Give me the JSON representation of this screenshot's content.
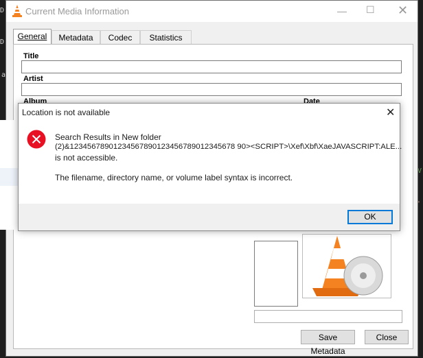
{
  "vlc": {
    "title": "Current Media Information",
    "tabs": [
      {
        "label": "General"
      },
      {
        "label": "Metadata"
      },
      {
        "label": "Codec"
      },
      {
        "label": "Statistics"
      }
    ],
    "labels": {
      "title": "Title",
      "artist": "Artist",
      "album": "Album",
      "date": "Date"
    },
    "buttons": {
      "save": "Save Metadata",
      "close": "Close"
    }
  },
  "dialog": {
    "title": "Location is not available",
    "line1": "Search Results in New folder",
    "line2": "(2)&12345678901234567890123456789012345678 90><SCRIPT>\\Xef\\Xbf\\XaeJAVASCRIPT:ALE...",
    "line3": "is not accessible.",
    "detail": "The filename, directory name, or volume label syntax is incorrect.",
    "ok": "OK"
  },
  "editor": {
    "frag1": "D",
    "frag2": "D",
    "frag3": "a",
    "frag4": "V",
    "frag5": "\""
  },
  "colors": {
    "error_red": "#e81123",
    "accent_blue": "#0078d7",
    "vlc_orange": "#f58220"
  }
}
